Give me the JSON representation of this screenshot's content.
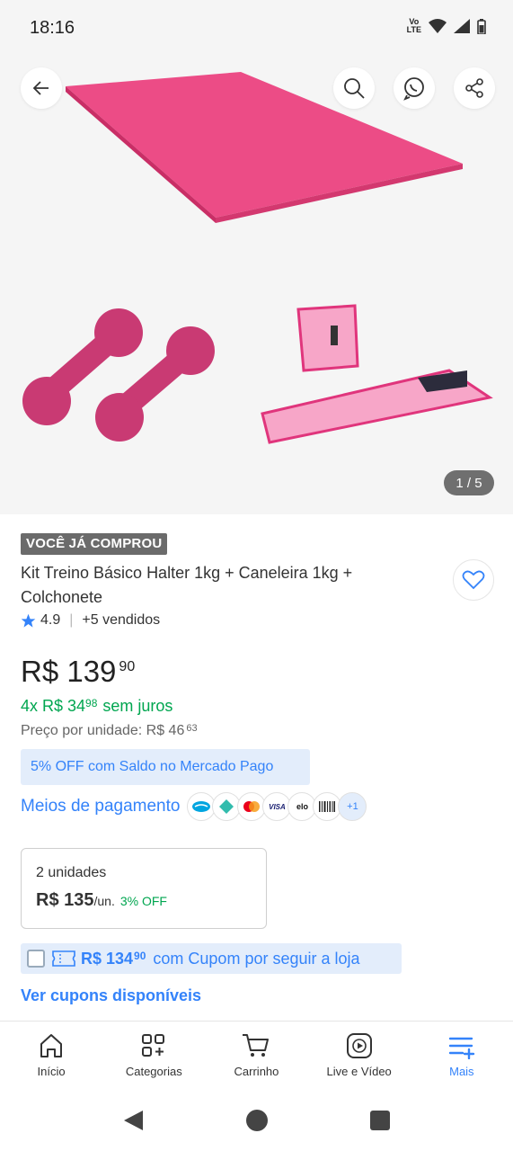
{
  "status_bar": {
    "time": "18:16",
    "network": "Vo LTE"
  },
  "gallery": {
    "page_indicator": "1 / 5"
  },
  "product": {
    "badge": "VOCÊ JÁ COMPROU",
    "title": "Kit Treino Básico Halter 1kg + Caneleira 1kg + Colchonete",
    "rating": "4.9",
    "sold": "+5 vendidos",
    "price_int": "R$ 139",
    "price_cents": "90",
    "installments_prefix": "4x R$ 34",
    "installments_cents": "98",
    "installments_suffix": "sem juros",
    "unit_price_label": "Preço por unidade: R$ 46",
    "unit_price_cents": "63",
    "discount_banner": "5% OFF com Saldo no Mercado Pago",
    "payment_link": "Meios de pagamento",
    "payment_more": "+1",
    "payment_methods": [
      "mercado-pago-icon",
      "pix-icon",
      "mastercard-icon",
      "visa-icon",
      "elo-icon",
      "boleto-icon"
    ]
  },
  "bulk": {
    "qty": "2 unidades",
    "price": "R$ 135",
    "unit": "/un.",
    "off": "3% OFF"
  },
  "coupon": {
    "price_int": "R$ 134",
    "price_cents": "90",
    "text": "com Cupom por seguir a loja",
    "see_all": "Ver cupons disponíveis"
  },
  "nav": {
    "items": [
      {
        "label": "Início"
      },
      {
        "label": "Categorias"
      },
      {
        "label": "Carrinho"
      },
      {
        "label": "Live e Vídeo"
      },
      {
        "label": "Mais"
      }
    ]
  },
  "colors": {
    "brand_blue": "#3483fa",
    "green": "#00a650",
    "mat_pink": "#e8457c"
  }
}
